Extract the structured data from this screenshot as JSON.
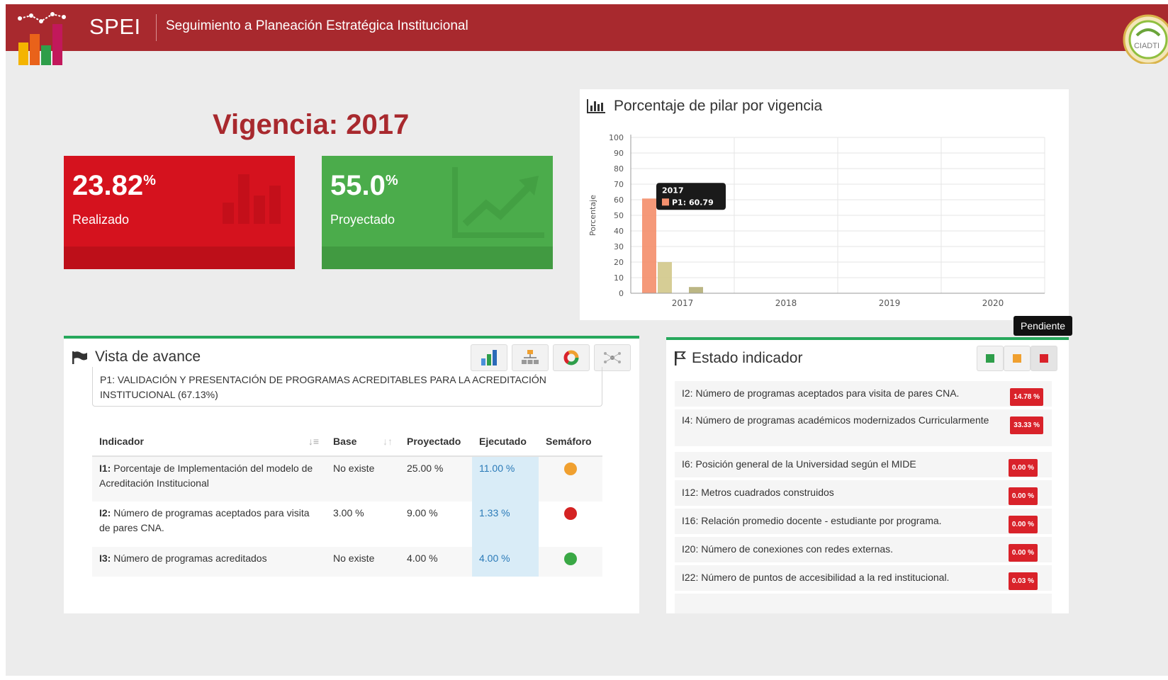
{
  "header": {
    "brand": "SPEI",
    "subtitle": "Seguimiento a Planeación Estratégica Institucional",
    "partner_logo_text": "CIADTI",
    "bar_color": "#a8292e"
  },
  "vigencia": {
    "label": "Vigencia: 2017"
  },
  "kpis": [
    {
      "value": "23.82",
      "unit": "%",
      "label": "Realizado",
      "color": "#d5121e"
    },
    {
      "value": "55.0",
      "unit": "%",
      "label": "Proyectado",
      "color": "#4bac4b"
    }
  ],
  "chart_panel": {
    "title": "Porcentaje de pilar por vigencia",
    "icon": "bar-chart-icon"
  },
  "chart_data": {
    "type": "bar",
    "title": "Porcentaje de pilar por vigencia",
    "xlabel": "",
    "ylabel": "Porcentaje",
    "categories": [
      "2017",
      "2018",
      "2019",
      "2020"
    ],
    "series": [
      {
        "values": [
          60.79,
          0,
          0,
          0
        ],
        "color": "#f4906e"
      },
      {
        "values": [
          20,
          0,
          0,
          0
        ],
        "color": "#d2c98c"
      },
      {
        "values": [
          0,
          0,
          0,
          0
        ],
        "color": "#c9c9c9"
      },
      {
        "values": [
          4,
          0,
          0,
          0
        ],
        "color": "#b5b07a"
      }
    ],
    "yticks": [
      "0",
      "10",
      "20",
      "30",
      "40",
      "50",
      "60",
      "70",
      "80",
      "90",
      "100"
    ],
    "ylim": [
      0,
      100
    ],
    "grid": true,
    "tooltip": {
      "title": "2017",
      "text": "P1: 60.79"
    }
  },
  "vista": {
    "title": "Vista de avance",
    "toolbar": [
      "bar-chart-icon",
      "hierarchy-icon",
      "donut-chart-icon",
      "network-icon"
    ],
    "pillar_text": "P1: VALIDACIÓN Y PRESENTACIÓN DE PROGRAMAS ACREDITABLES PARA LA ACREDITACIÓN INSTITUCIONAL (67.13%)",
    "columns": [
      "Indicador",
      "Base",
      "Proyectado",
      "Ejecutado",
      "Semáforo"
    ],
    "rows": [
      {
        "code": "I1:",
        "name": "Porcentaje de Implementación del modelo de Acreditación Institucional",
        "base": "No existe",
        "proyectado": "25.00 %",
        "ejecutado": "11.00 %",
        "semaforo": "#f0a030"
      },
      {
        "code": "I2:",
        "name": "Número de programas aceptados para visita de pares CNA.",
        "base": "3.00 %",
        "proyectado": "9.00 %",
        "ejecutado": "1.33 %",
        "semaforo": "#d42323"
      },
      {
        "code": "I3:",
        "name": "Número de programas acreditados",
        "base": "No existe",
        "proyectado": "4.00 %",
        "ejecutado": "4.00 %",
        "semaforo": "#3aa845"
      }
    ]
  },
  "estado": {
    "title": "Estado indicador",
    "filters": [
      {
        "name": "filter-green",
        "color": "#2e9e4a"
      },
      {
        "name": "filter-orange",
        "color": "#f0a030"
      },
      {
        "name": "filter-red",
        "color": "#d9222a"
      }
    ],
    "tooltip": "Pendiente",
    "items": [
      {
        "text": "I2: Número de programas aceptados para visita de pares CNA.",
        "badge": "14.78 %"
      },
      {
        "text": "I4: Número de programas académicos modernizados Curricularmente",
        "badge": "33.33 %"
      },
      {
        "text": "I6: Posición general de la Universidad según el MIDE",
        "badge": "0.00 %"
      },
      {
        "text": "I12: Metros cuadrados construidos",
        "badge": "0.00 %"
      },
      {
        "text": "I16: Relación promedio docente - estudiante por programa.",
        "badge": "0.00 %"
      },
      {
        "text": "I20: Número de conexiones con redes externas.",
        "badge": "0.00 %"
      },
      {
        "text": "I22: Número de puntos de accesibilidad a la red institucional.",
        "badge": "0.03 %"
      }
    ]
  }
}
